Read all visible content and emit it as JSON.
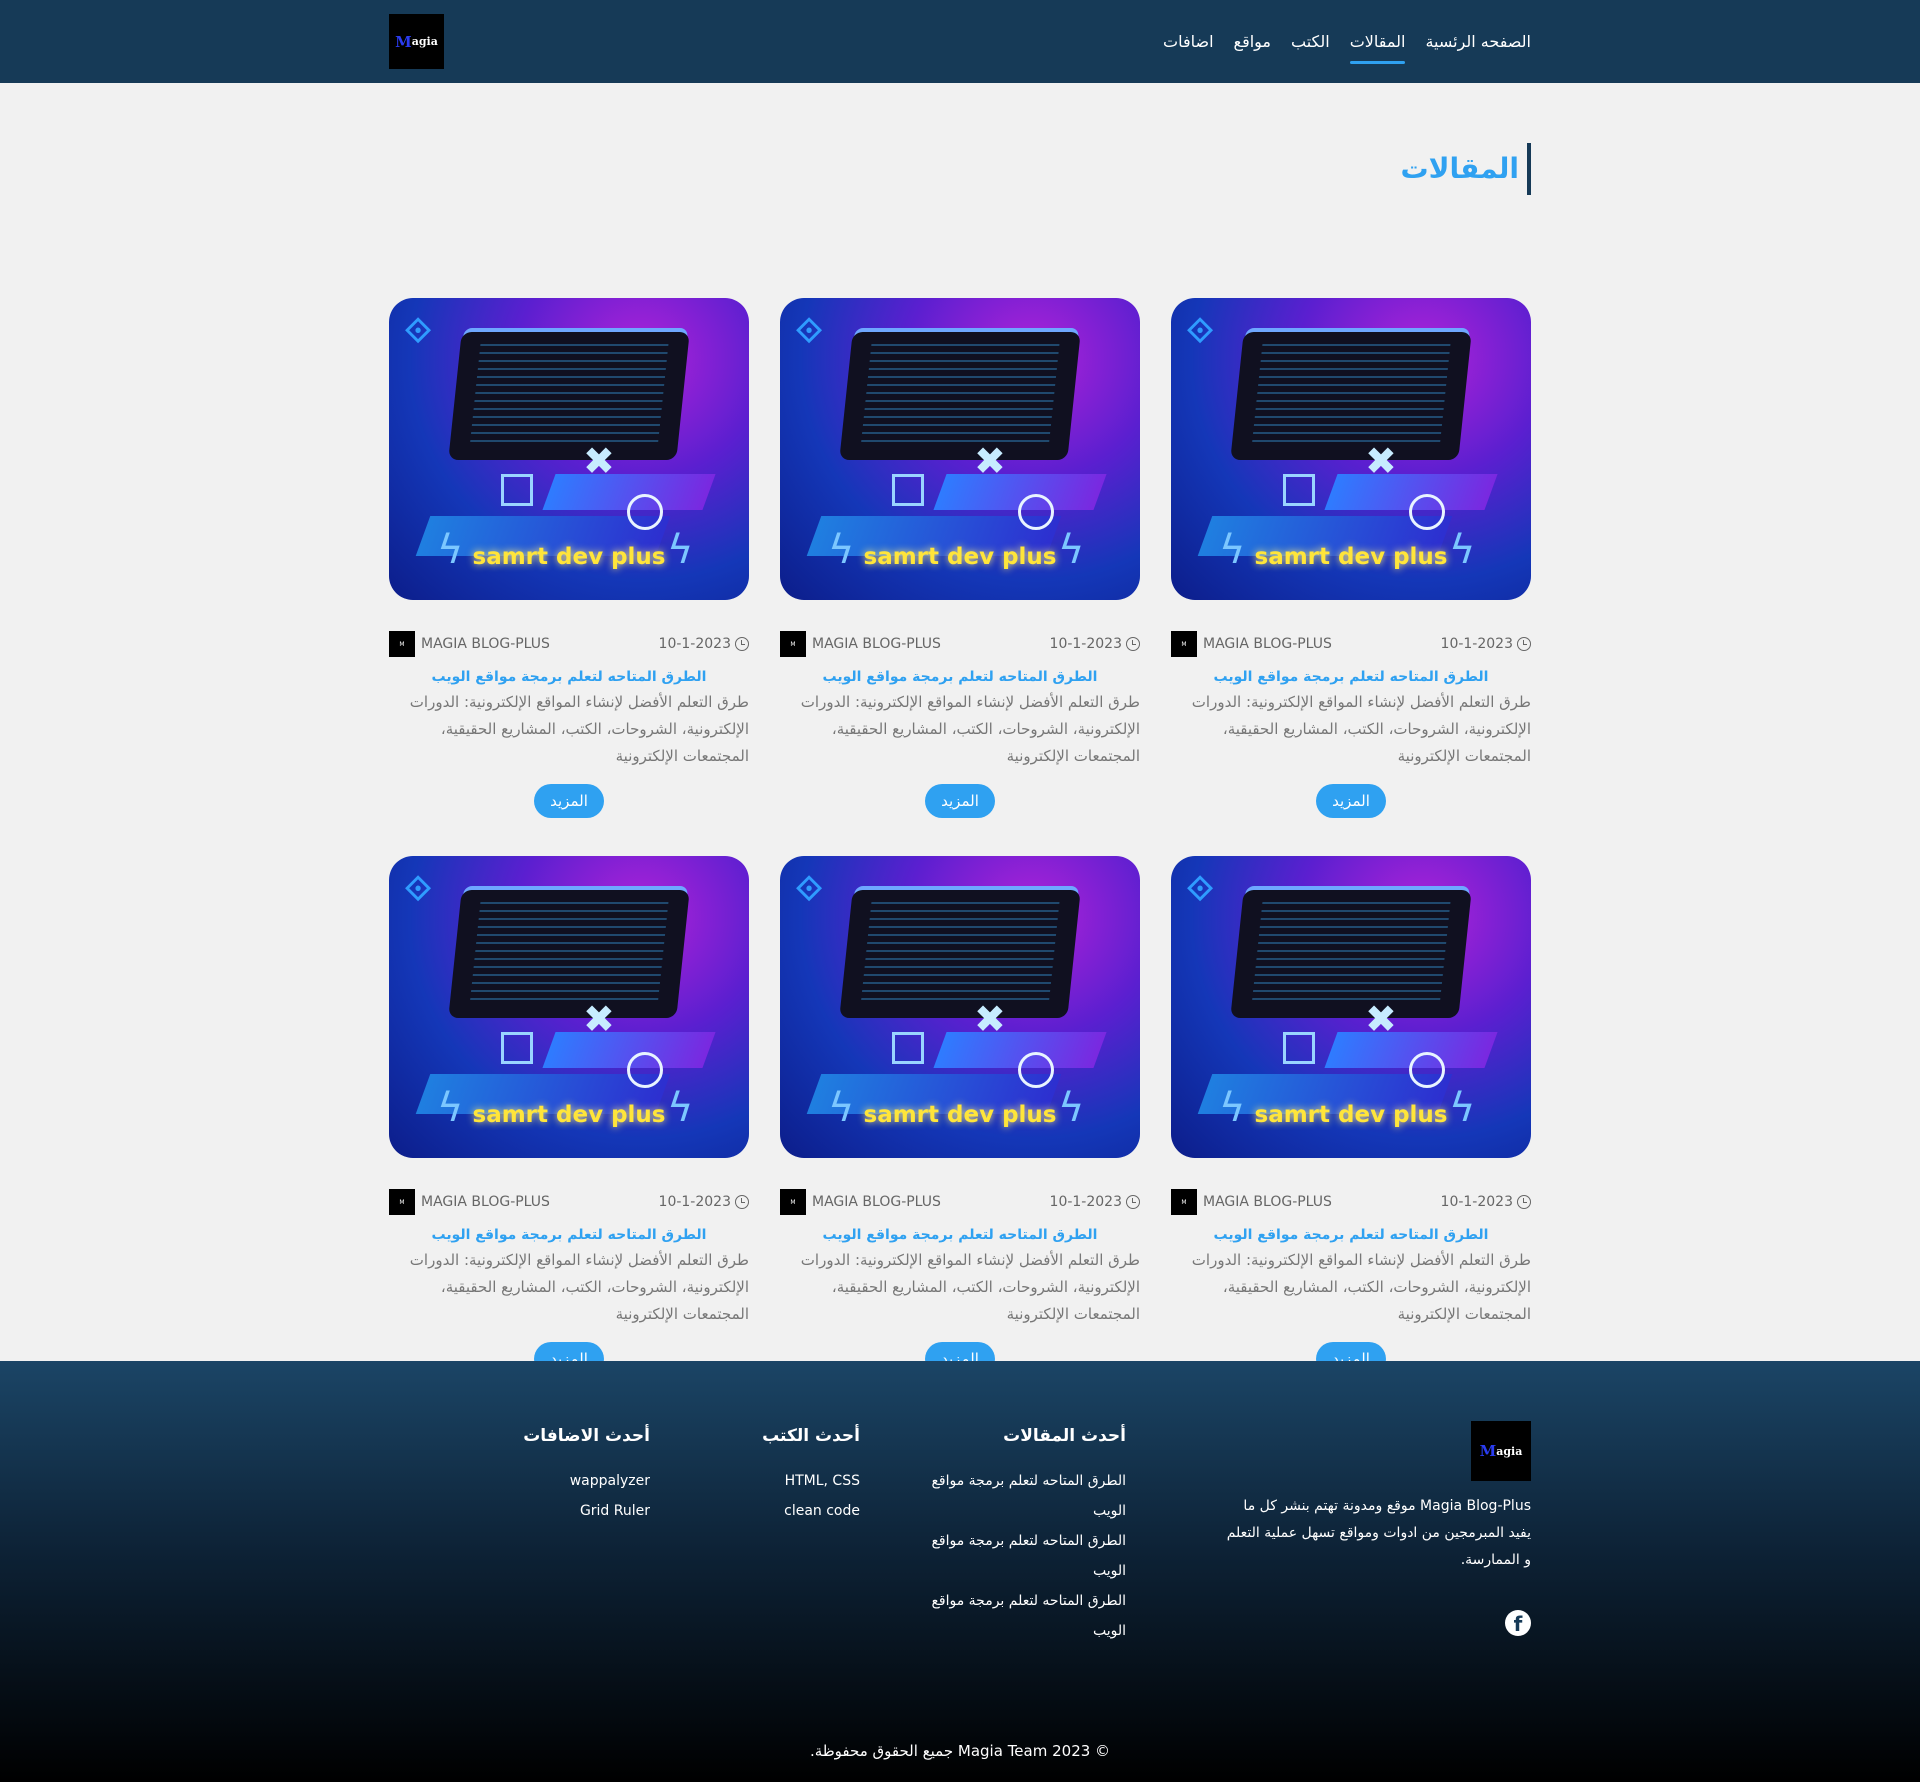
{
  "header": {
    "logo_text": "agia",
    "logo_letter": "M",
    "nav": [
      {
        "label": "الصفحه الرئسية",
        "active": false
      },
      {
        "label": "المقالات",
        "active": true
      },
      {
        "label": "الكتب",
        "active": false
      },
      {
        "label": "مواقع",
        "active": false
      },
      {
        "label": "اضافات",
        "active": false
      }
    ]
  },
  "main": {
    "section_title": "المقالات",
    "cards": [
      {
        "image_text": "samrt dev plus",
        "date": "10-1-2023",
        "author": "MAGIA BLOG-PLUS",
        "title": "الطرق المتاحه لتعلم برمجة مواقع الويب",
        "excerpt": "طرق التعلم الأفضل لإنشاء المواقع الإلكترونية: الدورات الإلكترونية، الشروحات، الكتب، المشاريع الحقيقية، المجتمعات الإلكترونية",
        "button": "المزيد"
      },
      {
        "image_text": "samrt dev plus",
        "date": "10-1-2023",
        "author": "MAGIA BLOG-PLUS",
        "title": "الطرق المتاحه لتعلم برمجة مواقع الويب",
        "excerpt": "طرق التعلم الأفضل لإنشاء المواقع الإلكترونية: الدورات الإلكترونية، الشروحات، الكتب، المشاريع الحقيقية، المجتمعات الإلكترونية",
        "button": "المزيد"
      },
      {
        "image_text": "samrt dev plus",
        "date": "10-1-2023",
        "author": "MAGIA BLOG-PLUS",
        "title": "الطرق المتاحه لتعلم برمجة مواقع الويب",
        "excerpt": "طرق التعلم الأفضل لإنشاء المواقع الإلكترونية: الدورات الإلكترونية، الشروحات، الكتب، المشاريع الحقيقية، المجتمعات الإلكترونية",
        "button": "المزيد"
      },
      {
        "image_text": "samrt dev plus",
        "date": "10-1-2023",
        "author": "MAGIA BLOG-PLUS",
        "title": "الطرق المتاحه لتعلم برمجة مواقع الويب",
        "excerpt": "طرق التعلم الأفضل لإنشاء المواقع الإلكترونية: الدورات الإلكترونية، الشروحات، الكتب، المشاريع الحقيقية، المجتمعات الإلكترونية",
        "button": "المزيد"
      },
      {
        "image_text": "samrt dev plus",
        "date": "10-1-2023",
        "author": "MAGIA BLOG-PLUS",
        "title": "الطرق المتاحه لتعلم برمجة مواقع الويب",
        "excerpt": "طرق التعلم الأفضل لإنشاء المواقع الإلكترونية: الدورات الإلكترونية، الشروحات، الكتب، المشاريع الحقيقية، المجتمعات الإلكترونية",
        "button": "المزيد"
      },
      {
        "image_text": "samrt dev plus",
        "date": "10-1-2023",
        "author": "MAGIA BLOG-PLUS",
        "title": "الطرق المتاحه لتعلم برمجة مواقع الويب",
        "excerpt": "طرق التعلم الأفضل لإنشاء المواقع الإلكترونية: الدورات الإلكترونية، الشروحات، الكتب، المشاريع الحقيقية، المجتمعات الإلكترونية",
        "button": "المزيد"
      }
    ]
  },
  "footer": {
    "about": "Magia Blog-Plus موقع ومدونة تهتم بنشر كل ما يفيد المبرمجين من ادوات ومواقع تسهل عملية التعلم و الممارسة.",
    "latest_articles": {
      "title": "أحدث المقالات",
      "items": [
        "الطرق المتاحه لتعلم برمجة مواقع الويب",
        "الطرق المتاحه لتعلم برمجة مواقع الويب",
        "الطرق المتاحه لتعلم برمجة مواقع الويب"
      ]
    },
    "latest_books": {
      "title": "أحدث الكتب",
      "items": [
        "HTML, CSS",
        "clean code"
      ]
    },
    "latest_addons": {
      "title": "أحدث الاضافات",
      "items": [
        "wappalyzer",
        "Grid Ruler"
      ]
    },
    "copyright": "© Magia Team 2023 جميع الحقوق محفوظة."
  },
  "colors": {
    "header_bg": "#163a57",
    "accent": "#2fa1f1",
    "page_bg": "#f1f1f1"
  }
}
